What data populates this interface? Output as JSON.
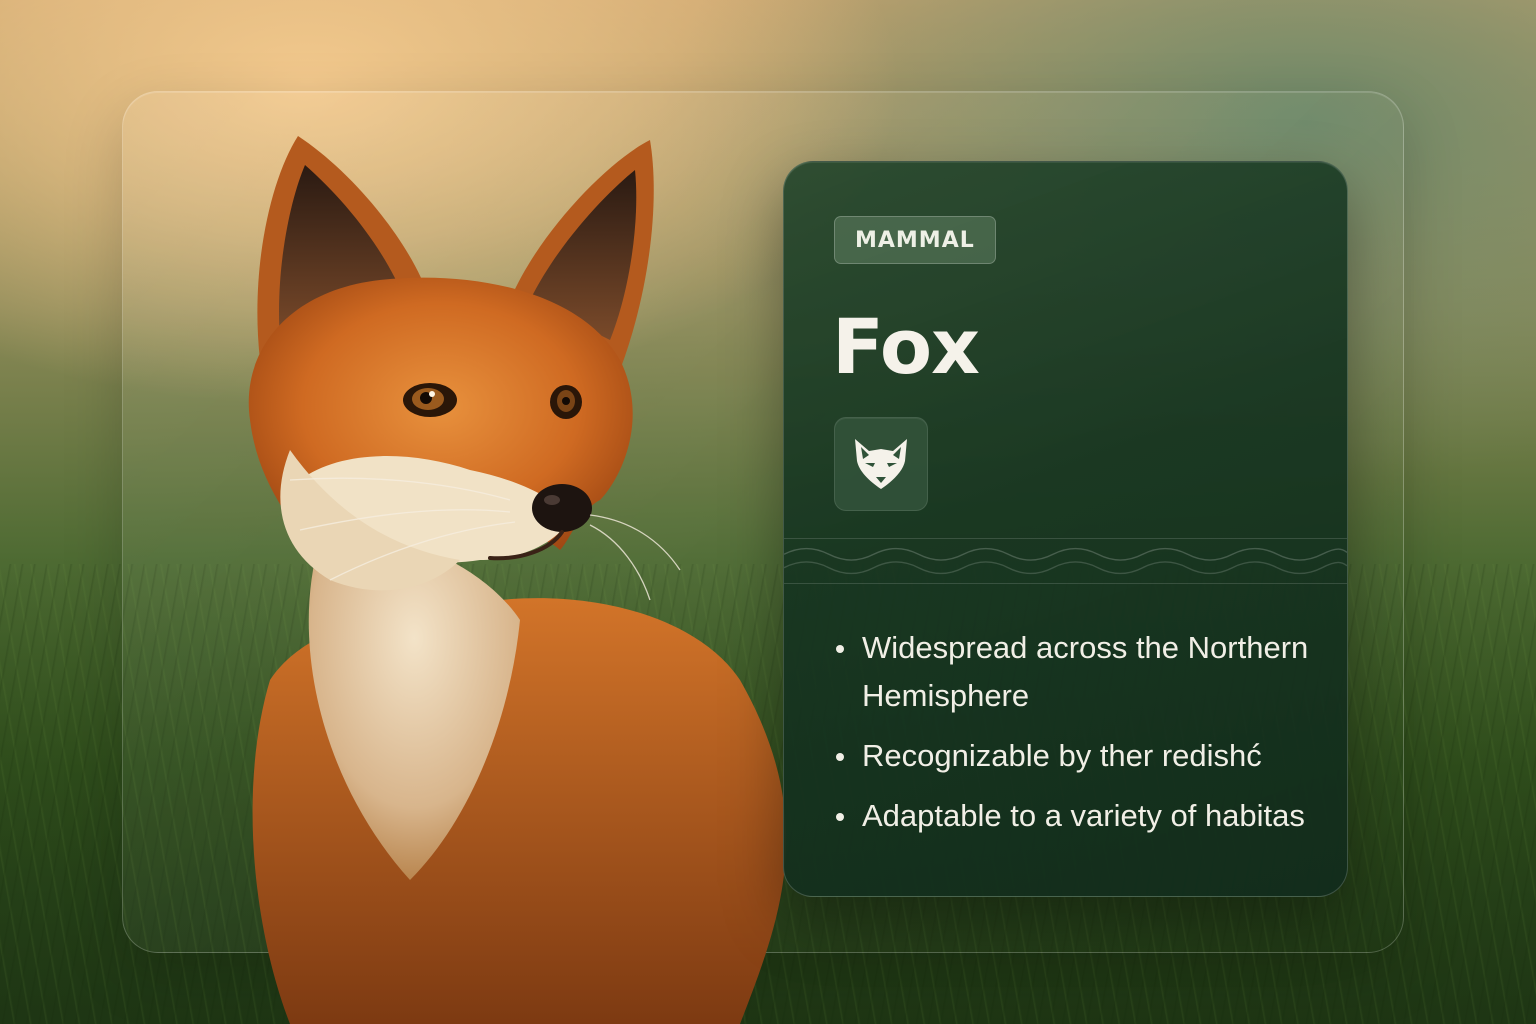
{
  "card": {
    "category_badge": "MAMMAL",
    "title": "Fox",
    "icon": "fox-face-icon",
    "facts": [
      "Widespread across the Northern Hemisphere",
      "Recognizable by ther redishć",
      "Adaptable to a variety of habitas"
    ]
  },
  "colors": {
    "panel_background": "#1c3a26",
    "badge_background": "#5f7d63",
    "text_primary": "#f5f2ea",
    "fox_fur": "#d9762a",
    "background_warm": "#f3c98d",
    "background_grass": "#35561f"
  }
}
